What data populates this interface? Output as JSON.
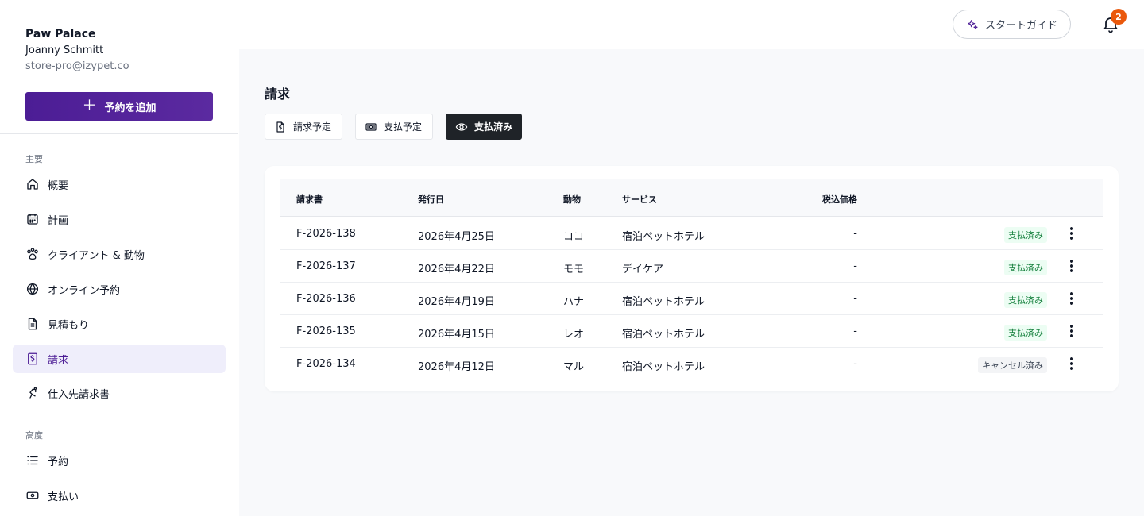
{
  "account": {
    "store_name": "Paw Palace",
    "user_name": "Joanny Schmitt",
    "email": "store-pro@izypet.co"
  },
  "sidebar": {
    "add_button": "予約を追加",
    "sections": [
      {
        "label": "主要",
        "items": [
          {
            "label": "概要",
            "icon": "home-icon"
          },
          {
            "label": "計画",
            "icon": "calendar-icon"
          },
          {
            "label": "クライアント & 動物",
            "icon": "paw-icon"
          },
          {
            "label": "オンライン予約",
            "icon": "globe-icon"
          },
          {
            "label": "見積もり",
            "icon": "document-icon"
          },
          {
            "label": "請求",
            "icon": "invoice-dollar-icon",
            "active": true
          },
          {
            "label": "仕入先請求書",
            "icon": "supplier-icon"
          }
        ]
      },
      {
        "label": "高度",
        "items": [
          {
            "label": "予約",
            "icon": "list-icon"
          },
          {
            "label": "支払い",
            "icon": "cash-icon"
          }
        ]
      }
    ]
  },
  "topbar": {
    "guide_label": "スタートガイド",
    "notification_count": "2"
  },
  "page": {
    "title": "請求",
    "tabs": [
      {
        "label": "請求予定",
        "icon": "invoice-icon",
        "active": false
      },
      {
        "label": "支払予定",
        "icon": "money-icon",
        "active": false
      },
      {
        "label": "支払済み",
        "icon": "eye-icon",
        "active": true
      }
    ]
  },
  "table": {
    "headers": [
      "請求書",
      "発行日",
      "動物",
      "サービス",
      "税込価格"
    ],
    "rows": [
      {
        "invoice": "F-2026-138",
        "date": "2026年4月25日",
        "animal": "ココ",
        "service": "宿泊ペットホテル",
        "price": "-",
        "status": "支払済み",
        "status_type": "paid"
      },
      {
        "invoice": "F-2026-137",
        "date": "2026年4月22日",
        "animal": "モモ",
        "service": "デイケア",
        "price": "-",
        "status": "支払済み",
        "status_type": "paid"
      },
      {
        "invoice": "F-2026-136",
        "date": "2026年4月19日",
        "animal": "ハナ",
        "service": "宿泊ペットホテル",
        "price": "-",
        "status": "支払済み",
        "status_type": "paid"
      },
      {
        "invoice": "F-2026-135",
        "date": "2026年4月15日",
        "animal": "レオ",
        "service": "宿泊ペットホテル",
        "price": "-",
        "status": "支払済み",
        "status_type": "paid"
      },
      {
        "invoice": "F-2026-134",
        "date": "2026年4月12日",
        "animal": "マル",
        "service": "宿泊ペットホテル",
        "price": "-",
        "status": "キャンセル済み",
        "status_type": "cancel"
      }
    ]
  },
  "colors": {
    "brand": "#4c1d95",
    "badge": "#ea580c",
    "paid_bg": "#ecfdf3",
    "paid_text": "#15803d"
  }
}
